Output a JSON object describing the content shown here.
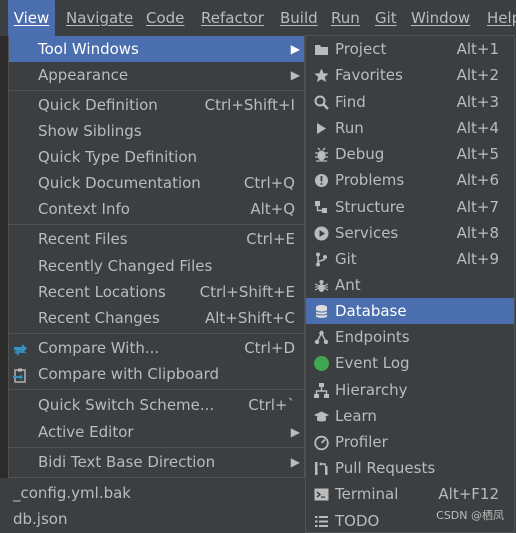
{
  "menubar": {
    "items": [
      {
        "label": "View",
        "active": true
      },
      {
        "label": "Navigate"
      },
      {
        "label": "Code"
      },
      {
        "label": "Refactor"
      },
      {
        "label": "Build"
      },
      {
        "label": "Run"
      },
      {
        "label": "Git"
      },
      {
        "label": "Window"
      },
      {
        "label": "Help"
      }
    ]
  },
  "view_menu": {
    "items": [
      {
        "label": "Tool Windows",
        "submenu": true,
        "selected": true
      },
      {
        "label": "Appearance",
        "submenu": true
      },
      {
        "label": "Quick Definition",
        "shortcut": "Ctrl+Shift+I"
      },
      {
        "label": "Show Siblings"
      },
      {
        "label": "Quick Type Definition"
      },
      {
        "label": "Quick Documentation",
        "shortcut": "Ctrl+Q"
      },
      {
        "label": "Context Info",
        "shortcut": "Alt+Q"
      },
      {
        "label": "Recent Files",
        "shortcut": "Ctrl+E"
      },
      {
        "label": "Recently Changed Files"
      },
      {
        "label": "Recent Locations",
        "shortcut": "Ctrl+Shift+E"
      },
      {
        "label": "Recent Changes",
        "shortcut": "Alt+Shift+C"
      },
      {
        "label": "Compare With...",
        "shortcut": "Ctrl+D",
        "icon": "compare-arrows-icon"
      },
      {
        "label": "Compare with Clipboard",
        "icon": "compare-clipboard-icon"
      },
      {
        "label": "Quick Switch Scheme...",
        "shortcut": "Ctrl+`"
      },
      {
        "label": "Active Editor",
        "submenu": true
      },
      {
        "label": "Bidi Text Base Direction",
        "submenu": true
      }
    ]
  },
  "tool_windows_menu": {
    "items": [
      {
        "label": "Project",
        "shortcut": "Alt+1",
        "icon": "folder-icon"
      },
      {
        "label": "Favorites",
        "shortcut": "Alt+2",
        "icon": "star-icon"
      },
      {
        "label": "Find",
        "shortcut": "Alt+3",
        "icon": "search-icon"
      },
      {
        "label": "Run",
        "shortcut": "Alt+4",
        "icon": "play-icon"
      },
      {
        "label": "Debug",
        "shortcut": "Alt+5",
        "icon": "bug-icon"
      },
      {
        "label": "Problems",
        "shortcut": "Alt+6",
        "icon": "warning-icon"
      },
      {
        "label": "Structure",
        "shortcut": "Alt+7",
        "icon": "structure-icon"
      },
      {
        "label": "Services",
        "shortcut": "Alt+8",
        "icon": "services-icon"
      },
      {
        "label": "Git",
        "shortcut": "Alt+9",
        "icon": "git-branch-icon"
      },
      {
        "label": "Ant",
        "icon": "ant-icon"
      },
      {
        "label": "Database",
        "icon": "database-icon",
        "selected": true
      },
      {
        "label": "Endpoints",
        "icon": "endpoints-icon"
      },
      {
        "label": "Event Log",
        "icon": "event-log-icon",
        "color": "#3fa652"
      },
      {
        "label": "Hierarchy",
        "icon": "hierarchy-icon"
      },
      {
        "label": "Learn",
        "icon": "learn-icon"
      },
      {
        "label": "Profiler",
        "icon": "profiler-icon"
      },
      {
        "label": "Pull Requests",
        "icon": "pull-request-icon"
      },
      {
        "label": "Terminal",
        "shortcut": "Alt+F12",
        "icon": "terminal-icon"
      },
      {
        "label": "TODO",
        "icon": "todo-icon"
      }
    ]
  },
  "background_files": [
    "_config.yml.bak",
    "db.json"
  ],
  "watermark": "CSDN @栖凤",
  "colors": {
    "selection": "#4b6eaf",
    "menu_bg": "#3c3f41",
    "text": "#bbbbbb",
    "event_log_green": "#3fa652"
  }
}
